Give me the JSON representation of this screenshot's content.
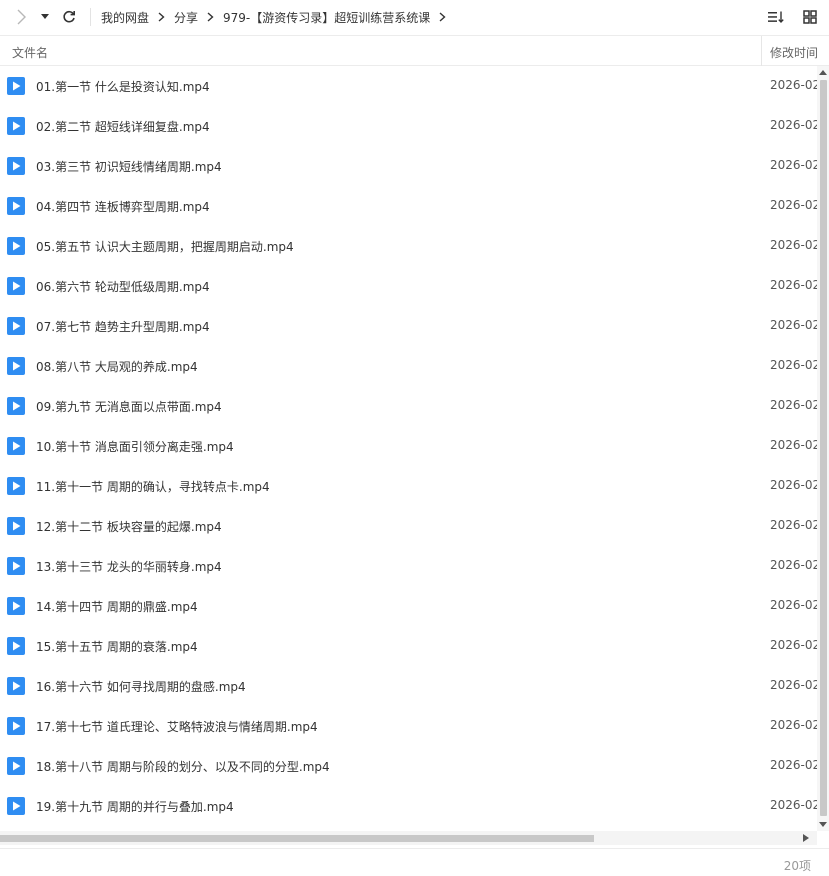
{
  "toolbar": {
    "breadcrumb": [
      "我的网盘",
      "分享",
      "979-【游资传习录】超短训练营系统课"
    ]
  },
  "header": {
    "name_col": "文件名",
    "date_col": "修改时间"
  },
  "files": [
    {
      "name": "01.第一节 什么是投资认知.mp4",
      "date": "2026-02"
    },
    {
      "name": "02.第二节 超短线详细复盘.mp4",
      "date": "2026-02"
    },
    {
      "name": "03.第三节 初识短线情绪周期.mp4",
      "date": "2026-02"
    },
    {
      "name": "04.第四节 连板博弈型周期.mp4",
      "date": "2026-02"
    },
    {
      "name": "05.第五节 认识大主题周期，把握周期启动.mp4",
      "date": "2026-02"
    },
    {
      "name": "06.第六节 轮动型低级周期.mp4",
      "date": "2026-02"
    },
    {
      "name": "07.第七节 趋势主升型周期.mp4",
      "date": "2026-02"
    },
    {
      "name": "08.第八节 大局观的养成.mp4",
      "date": "2026-02"
    },
    {
      "name": "09.第九节 无消息面以点带面.mp4",
      "date": "2026-02"
    },
    {
      "name": "10.第十节 消息面引领分离走强.mp4",
      "date": "2026-02"
    },
    {
      "name": "11.第十一节 周期的确认，寻找转点卡.mp4",
      "date": "2026-02"
    },
    {
      "name": "12.第十二节 板块容量的起爆.mp4",
      "date": "2026-02"
    },
    {
      "name": "13.第十三节 龙头的华丽转身.mp4",
      "date": "2026-02"
    },
    {
      "name": "14.第十四节 周期的鼎盛.mp4",
      "date": "2026-02"
    },
    {
      "name": "15.第十五节 周期的衰落.mp4",
      "date": "2026-02"
    },
    {
      "name": "16.第十六节  如何寻找周期的盘感.mp4",
      "date": "2026-02"
    },
    {
      "name": "17.第十七节 道氏理论、艾略特波浪与情绪周期.mp4",
      "date": "2026-02"
    },
    {
      "name": "18.第十八节 周期与阶段的划分、以及不同的分型.mp4",
      "date": "2026-02"
    },
    {
      "name": "19.第十九节 周期的并行与叠加.mp4",
      "date": "2026-02"
    }
  ],
  "status": {
    "item_count": "20项"
  },
  "colors": {
    "file_icon": "#2f8df2",
    "scroll_thumb": "#c8c8c8"
  },
  "icons": {
    "file": "video-file-icon",
    "forward": "chevron-right-icon",
    "dropdown": "caret-down-icon",
    "refresh": "refresh-icon",
    "sort": "sort-list-icon",
    "view": "grid-view-icon"
  }
}
